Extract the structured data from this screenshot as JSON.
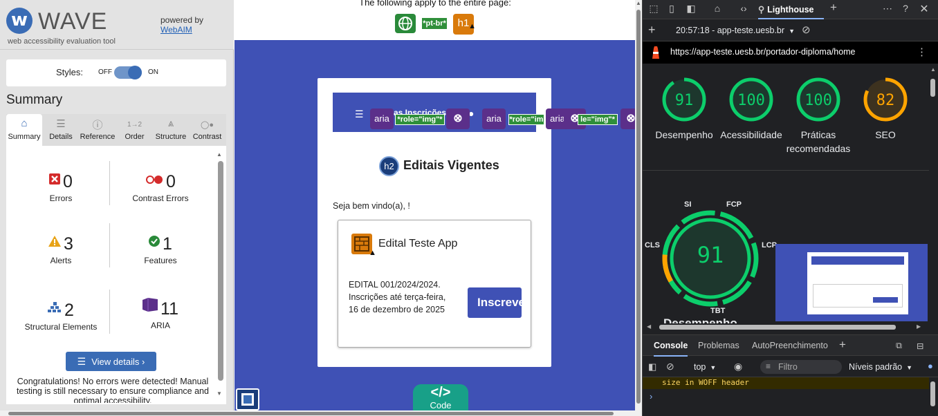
{
  "wave": {
    "logo_letter": "w",
    "logo_name": "WAVE",
    "tagline": "web accessibility evaluation tool",
    "powered_by": "powered by",
    "powered_link": "WebAIM",
    "styles_label": "Styles:",
    "styles_off": "OFF",
    "styles_on": "ON",
    "summary_title": "Summary",
    "tabs": [
      {
        "label": "Summary",
        "icon": "home-icon",
        "glyph": "⌂"
      },
      {
        "label": "Details",
        "icon": "list-icon",
        "glyph": "☰"
      },
      {
        "label": "Reference",
        "icon": "info-icon",
        "glyph": "ⓘ"
      },
      {
        "label": "Order",
        "icon": "order-icon",
        "glyph": "1→2"
      },
      {
        "label": "Structure",
        "icon": "structure-icon",
        "glyph": "⩓"
      },
      {
        "label": "Contrast",
        "icon": "contrast-icon",
        "glyph": "◯●"
      }
    ],
    "stats": {
      "errors": {
        "count": "0",
        "label": "Errors"
      },
      "contrast_errors": {
        "count": "0",
        "label": "Contrast Errors"
      },
      "alerts": {
        "count": "3",
        "label": "Alerts"
      },
      "features": {
        "count": "1",
        "label": "Features"
      },
      "structural": {
        "count": "2",
        "label": "Structural Elements"
      },
      "aria": {
        "count": "11",
        "label": "ARIA"
      }
    },
    "view_details": "View details ›",
    "congrats": "Congratulations! No errors were detected! Manual testing is still necessary to ensure compliance and optimal accessibility."
  },
  "page": {
    "top_note": "The following apply to the entire page:",
    "lang_tag": "*pt-br*",
    "h1_tag": "h1",
    "aria_tag": "aria",
    "role_img_tag": "*role=\"img\"*",
    "role_img_tag_cut": "*role=\"im",
    "role_img_tag_cut2": "le=\"img\"*",
    "toolbar_fragment": "as Inscrições",
    "h2_tag": "h2",
    "title": "Editais Vigentes",
    "welcome": "Seja bem vindo(a), !",
    "edital_name": "Edital Teste App",
    "edital_desc": "EDITAL 001/2024/2024. Inscrições até terça-feira, 16 de dezembro de 2025",
    "inscrever": "Inscrever",
    "code_label": "Code",
    "code_glyph": "</>"
  },
  "devtools": {
    "tab_lighthouse": "Lighthouse",
    "report_selector": "20:57:18 - app-teste.uesb.br",
    "url": "https://app-teste.uesb.br/portador-diploma/home",
    "scores": [
      {
        "value": 91,
        "label": "Desempenho",
        "color": "#0cce6b"
      },
      {
        "value": 100,
        "label": "Acessibilidade",
        "color": "#0cce6b"
      },
      {
        "value": 100,
        "label": "Práticas recomendadas",
        "color": "#0cce6b"
      },
      {
        "value": 82,
        "label": "SEO",
        "color": "#ffa400"
      }
    ],
    "perf_big_score": "91",
    "metrics": [
      "SI",
      "FCP",
      "LCP",
      "TBT",
      "CLS"
    ],
    "perf_title": "Desempenho",
    "drawer_tabs": [
      "Console",
      "Problemas",
      "AutoPreenchimento"
    ],
    "context": "top",
    "filter_placeholder": "Filtro",
    "levels": "Níveis padrão",
    "console_message": "size in WOFF header",
    "prompt": "›"
  }
}
